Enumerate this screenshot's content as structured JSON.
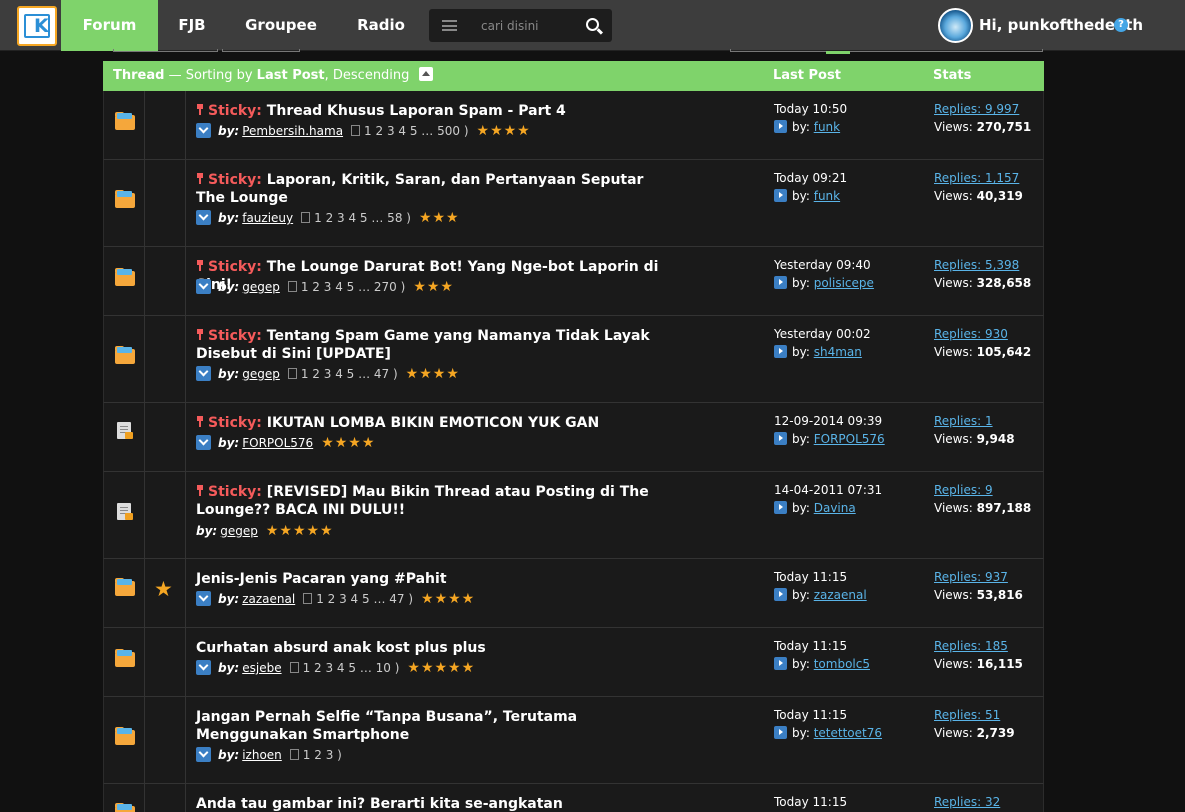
{
  "nav": {
    "tabs": [
      "Forum",
      "FJB",
      "Groupee",
      "Radio"
    ],
    "search_placeholder": "cari disini",
    "greeting": "Hi, punkofthedeath",
    "help": "?"
  },
  "table": {
    "header": {
      "thread": "Thread",
      "sort_sep": " — Sorting by ",
      "sort_field": "Last Post",
      "sort_order": ", Descending",
      "last_post": "Last Post",
      "stats": "Stats"
    },
    "rows": [
      {
        "icon": "folder-icon",
        "sticky": true,
        "sticky_label": "Sticky:",
        "title": "Thread Khusus Laporan Spam - Part 4",
        "by_label": "by:",
        "author": "Pembersih.hama",
        "pages": "1   2   3   4   5 … 500 )",
        "stars": "★★★★",
        "lastpost_date": "Today 10:50",
        "lastpost_by_label": "by:",
        "lastpost_user": "funk",
        "replies": "Replies: 9,997",
        "views_label": "Views: ",
        "views": "270,751"
      },
      {
        "icon": "folder-icon",
        "sticky": true,
        "sticky_label": "Sticky:",
        "title": "Laporan, Kritik, Saran, dan Pertanyaan Seputar The Lounge",
        "by_label": "by:",
        "author": "fauzieuy",
        "pages": "1   2   3   4   5 … 58 )",
        "stars": "★★★",
        "lastpost_date": "Today 09:21",
        "lastpost_by_label": "by:",
        "lastpost_user": "funk",
        "replies": "Replies: 1,157",
        "views_label": "Views: ",
        "views": "40,319"
      },
      {
        "icon": "folder-icon",
        "sticky": true,
        "sticky_label": "Sticky:",
        "title": "The Lounge Darurat Bot! Yang Nge-bot Laporin di Sini!",
        "by_label": "by:",
        "author": "gegep",
        "pages": "1   2   3   4   5 … 270 )",
        "stars": "★★★",
        "lastpost_date": "Yesterday 09:40",
        "lastpost_by_label": "by:",
        "lastpost_user": "polisicepe",
        "replies": "Replies: 5,398",
        "views_label": "Views: ",
        "views": "328,658"
      },
      {
        "icon": "folder-icon",
        "sticky": true,
        "sticky_label": "Sticky:",
        "title": "Tentang Spam Game yang Namanya Tidak Layak Disebut di Sini [UPDATE]",
        "by_label": "by:",
        "author": "gegep",
        "pages": "1   2   3   4   5 … 47 )",
        "stars": "★★★★",
        "lastpost_date": "Yesterday 00:02",
        "lastpost_by_label": "by:",
        "lastpost_user": "sh4man",
        "replies": "Replies: 930",
        "views_label": "Views: ",
        "views": "105,642"
      },
      {
        "icon": "locked-doc-icon",
        "sticky": true,
        "sticky_label": "Sticky:",
        "title": "IKUTAN LOMBA BIKIN EMOTICON YUK GAN",
        "by_label": "by:",
        "author": "FORPOL576",
        "pages": "",
        "stars": "★★★★",
        "lastpost_date": "12-09-2014 09:39",
        "lastpost_by_label": "by:",
        "lastpost_user": "FORPOL576",
        "replies": "Replies: 1",
        "views_label": "Views: ",
        "views": "9,948"
      },
      {
        "icon": "locked-doc-icon",
        "sticky": true,
        "sticky_label": "Sticky:",
        "title": "[REVISED] Mau Bikin Thread atau Posting di The Lounge?? BACA INI DULU!!",
        "by_label": "by:",
        "author": "gegep",
        "pages": "",
        "stars": "★★★★★",
        "lastpost_date": "14-04-2011 07:31",
        "lastpost_by_label": "by:",
        "lastpost_user": "Davina",
        "replies": "Replies: 9",
        "views_label": "Views: ",
        "views": "897,188"
      },
      {
        "icon": "folder-icon",
        "sticky": false,
        "starred": true,
        "title": "Jenis-Jenis Pacaran yang #Pahit",
        "by_label": "by:",
        "author": "zazaenal",
        "pages": "1   2   3   4   5 … 47 )",
        "stars": "★★★★",
        "lastpost_date": "Today 11:15",
        "lastpost_by_label": "by:",
        "lastpost_user": "zazaenal",
        "replies": "Replies: 937",
        "views_label": "Views: ",
        "views": "53,816"
      },
      {
        "icon": "folder-icon",
        "sticky": false,
        "title": "Curhatan absurd anak kost plus plus",
        "by_label": "by:",
        "author": "esjebe",
        "pages": "1   2   3   4   5 … 10 )",
        "stars": "★★★★★",
        "lastpost_date": "Today 11:15",
        "lastpost_by_label": "by:",
        "lastpost_user": "tombolc5",
        "replies": "Replies: 185",
        "views_label": "Views: ",
        "views": "16,115"
      },
      {
        "icon": "folder-icon",
        "sticky": false,
        "title": "Jangan Pernah Selfie “Tanpa Busana”, Terutama Menggunakan Smartphone",
        "by_label": "by:",
        "author": "izhoen",
        "pages": "1   2   3 )",
        "stars": "",
        "lastpost_date": "Today 11:15",
        "lastpost_by_label": "by:",
        "lastpost_user": "tetettoet76",
        "replies": "Replies: 51",
        "views_label": "Views: ",
        "views": "2,739"
      },
      {
        "icon": "folder-icon",
        "sticky": false,
        "title": "Anda tau gambar ini? Berarti kita se-angkatan",
        "by_label": "by:",
        "author": "",
        "pages": "",
        "stars": "",
        "lastpost_date": "Today 11:15",
        "lastpost_by_label": "",
        "lastpost_user": "",
        "replies": "Replies: 32",
        "views_label": "",
        "views": ""
      }
    ]
  }
}
